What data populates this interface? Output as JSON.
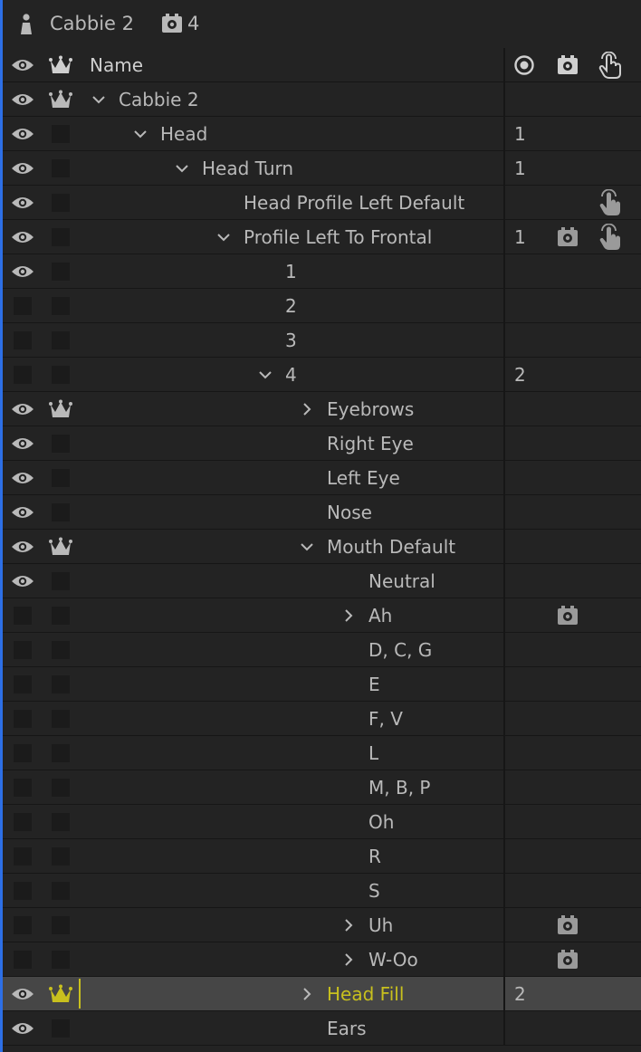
{
  "header": {
    "puppet_name": "Cabbie 2",
    "trigger_count": "4"
  },
  "columns": {
    "name": "Name"
  },
  "colors": {
    "selection_accent": "#c8c01e",
    "row_bg": "#232323",
    "selected_row_bg": "#464646",
    "left_accent": "#2d6fe6"
  },
  "rows": [
    {
      "label": "Cabbie 2",
      "depth": 0,
      "arrow": "down",
      "visible": true,
      "crown": true,
      "num": "",
      "trigger": false,
      "handle": false
    },
    {
      "label": "Head",
      "depth": 1,
      "arrow": "down",
      "visible": true,
      "crown": false,
      "num": "1",
      "trigger": false,
      "handle": false
    },
    {
      "label": "Head Turn",
      "depth": 2,
      "arrow": "down",
      "visible": true,
      "crown": false,
      "num": "1",
      "trigger": false,
      "handle": false
    },
    {
      "label": "Head Profile Left Default",
      "depth": 3,
      "arrow": "none",
      "visible": true,
      "crown": false,
      "num": "",
      "trigger": false,
      "handle": true
    },
    {
      "label": "Profile Left To Frontal",
      "depth": 3,
      "arrow": "down",
      "visible": true,
      "crown": false,
      "num": "1",
      "trigger": true,
      "handle": true
    },
    {
      "label": "1",
      "depth": 4,
      "arrow": "none",
      "visible": true,
      "crown": false,
      "num": "",
      "trigger": false,
      "handle": false
    },
    {
      "label": "2",
      "depth": 4,
      "arrow": "none",
      "visible": false,
      "crown": false,
      "num": "",
      "trigger": false,
      "handle": false
    },
    {
      "label": "3",
      "depth": 4,
      "arrow": "none",
      "visible": false,
      "crown": false,
      "num": "",
      "trigger": false,
      "handle": false
    },
    {
      "label": "4",
      "depth": 4,
      "arrow": "down",
      "visible": false,
      "crown": false,
      "num": "2",
      "trigger": false,
      "handle": false
    },
    {
      "label": "Eyebrows",
      "depth": 5,
      "arrow": "right",
      "visible": true,
      "crown": true,
      "num": "",
      "trigger": false,
      "handle": false
    },
    {
      "label": "Right Eye",
      "depth": 5,
      "arrow": "none",
      "visible": true,
      "crown": false,
      "num": "",
      "trigger": false,
      "handle": false
    },
    {
      "label": "Left Eye",
      "depth": 5,
      "arrow": "none",
      "visible": true,
      "crown": false,
      "num": "",
      "trigger": false,
      "handle": false
    },
    {
      "label": "Nose",
      "depth": 5,
      "arrow": "none",
      "visible": true,
      "crown": false,
      "num": "",
      "trigger": false,
      "handle": false
    },
    {
      "label": "Mouth Default",
      "depth": 5,
      "arrow": "down",
      "visible": true,
      "crown": true,
      "num": "",
      "trigger": false,
      "handle": false
    },
    {
      "label": "Neutral",
      "depth": 6,
      "arrow": "none",
      "visible": true,
      "crown": false,
      "num": "",
      "trigger": false,
      "handle": false
    },
    {
      "label": "Ah",
      "depth": 6,
      "arrow": "right",
      "visible": false,
      "crown": false,
      "num": "",
      "trigger": true,
      "handle": false
    },
    {
      "label": "D, C, G",
      "depth": 6,
      "arrow": "none",
      "visible": false,
      "crown": false,
      "num": "",
      "trigger": false,
      "handle": false
    },
    {
      "label": "E",
      "depth": 6,
      "arrow": "none",
      "visible": false,
      "crown": false,
      "num": "",
      "trigger": false,
      "handle": false
    },
    {
      "label": "F, V",
      "depth": 6,
      "arrow": "none",
      "visible": false,
      "crown": false,
      "num": "",
      "trigger": false,
      "handle": false
    },
    {
      "label": "L",
      "depth": 6,
      "arrow": "none",
      "visible": false,
      "crown": false,
      "num": "",
      "trigger": false,
      "handle": false
    },
    {
      "label": "M, B, P",
      "depth": 6,
      "arrow": "none",
      "visible": false,
      "crown": false,
      "num": "",
      "trigger": false,
      "handle": false
    },
    {
      "label": "Oh",
      "depth": 6,
      "arrow": "none",
      "visible": false,
      "crown": false,
      "num": "",
      "trigger": false,
      "handle": false
    },
    {
      "label": "R",
      "depth": 6,
      "arrow": "none",
      "visible": false,
      "crown": false,
      "num": "",
      "trigger": false,
      "handle": false
    },
    {
      "label": "S",
      "depth": 6,
      "arrow": "none",
      "visible": false,
      "crown": false,
      "num": "",
      "trigger": false,
      "handle": false
    },
    {
      "label": "Uh",
      "depth": 6,
      "arrow": "right",
      "visible": false,
      "crown": false,
      "num": "",
      "trigger": true,
      "handle": false
    },
    {
      "label": "W-Oo",
      "depth": 6,
      "arrow": "right",
      "visible": false,
      "crown": false,
      "num": "",
      "trigger": true,
      "handle": false
    },
    {
      "label": "Head Fill",
      "depth": 5,
      "arrow": "right",
      "visible": true,
      "crown": true,
      "num": "2",
      "trigger": false,
      "handle": false,
      "selected": true
    },
    {
      "label": "Ears",
      "depth": 5,
      "arrow": "none",
      "visible": true,
      "crown": false,
      "num": "",
      "trigger": false,
      "handle": false
    }
  ]
}
